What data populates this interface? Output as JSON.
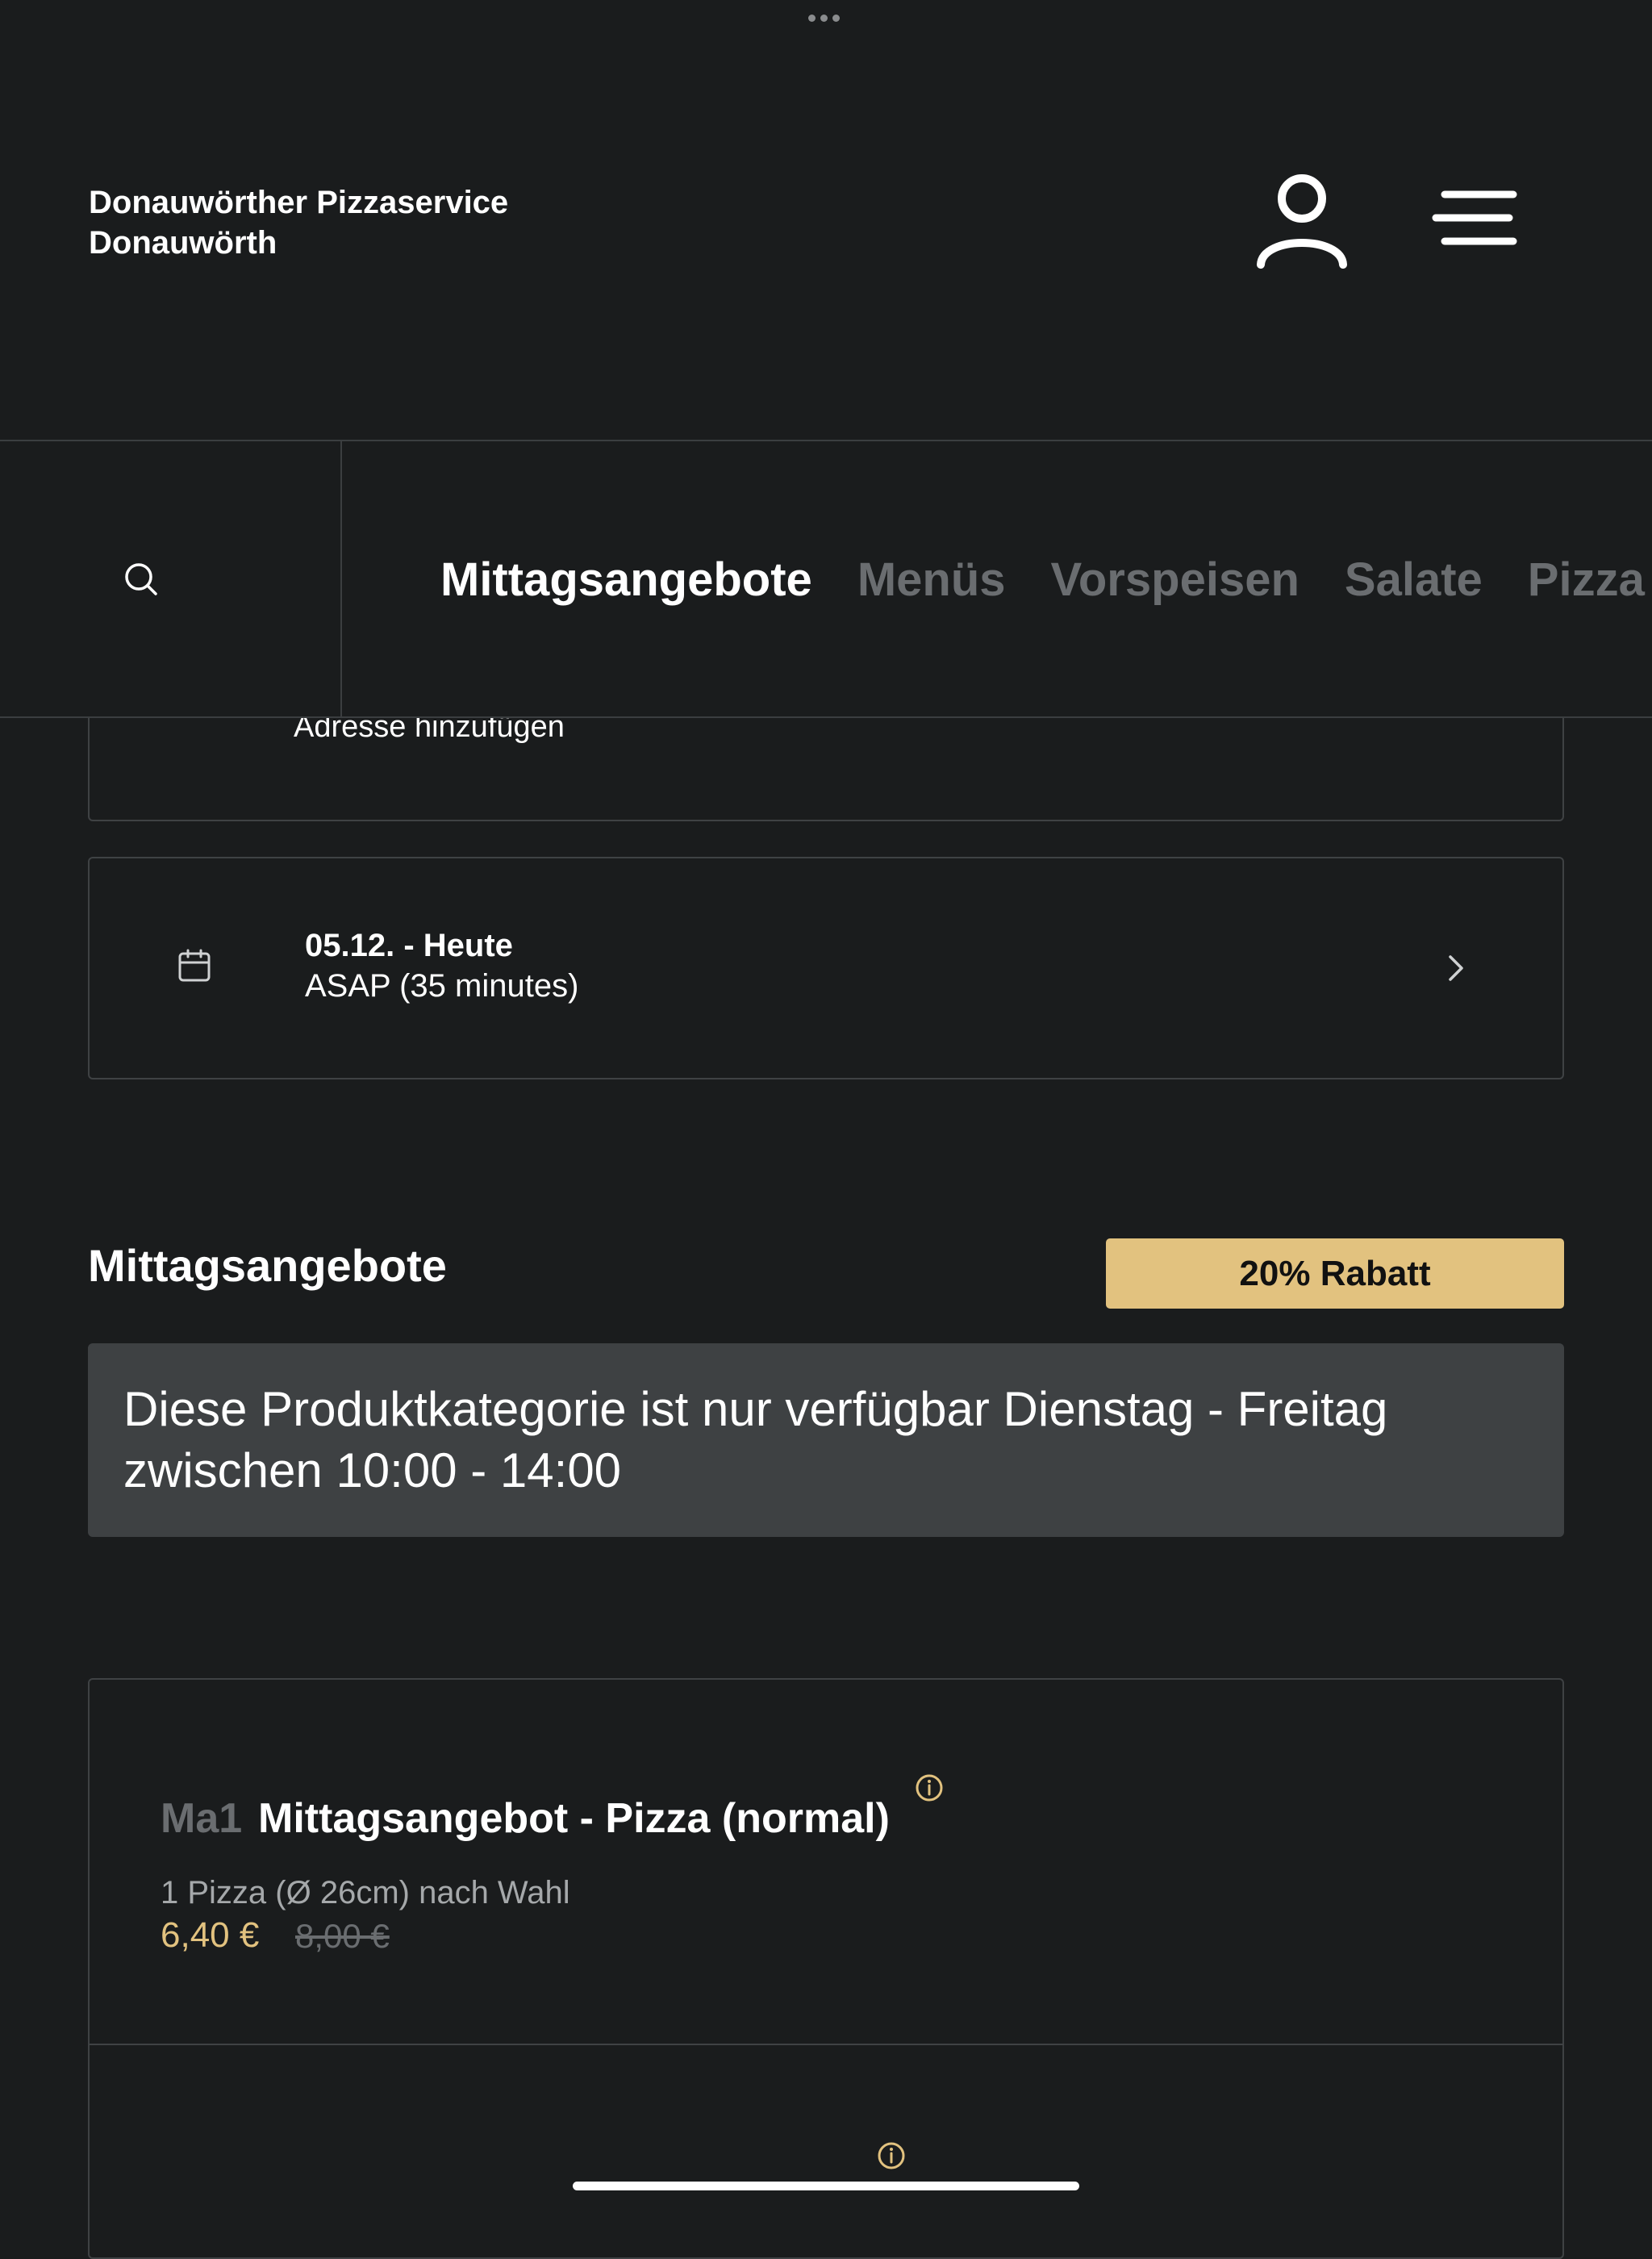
{
  "header": {
    "restaurant_name": "Donauwörther Pizzaservice",
    "city": "Donauwörth"
  },
  "nav": {
    "tabs": [
      {
        "label": "Mittagsangebote",
        "active": true
      },
      {
        "label": "Menüs",
        "active": false
      },
      {
        "label": "Vorspeisen",
        "active": false
      },
      {
        "label": "Salate",
        "active": false
      },
      {
        "label": "Pizza",
        "active": false
      }
    ]
  },
  "address": {
    "label": "Adresse hinzufügen"
  },
  "schedule": {
    "date_label": "05.12. - Heute",
    "time_label": "ASAP (35 minutes)"
  },
  "section": {
    "title": "Mittagsangebote",
    "badge": "20% Rabatt",
    "notice": "Diese Produktkategorie ist nur verfügbar Dienstag - Freitag zwischen 10:00 - 14:00"
  },
  "products": [
    {
      "code": "Ma1",
      "name": "Mittagsangebot - Pizza (normal)",
      "description": "1 Pizza (Ø 26cm) nach Wahl",
      "price": "6,40 €",
      "old_price": "8,00 €"
    }
  ],
  "colors": {
    "background": "#1a1c1d",
    "accent": "#e2c27f",
    "notice_bg": "#3e4143",
    "muted": "#6a6d70"
  }
}
